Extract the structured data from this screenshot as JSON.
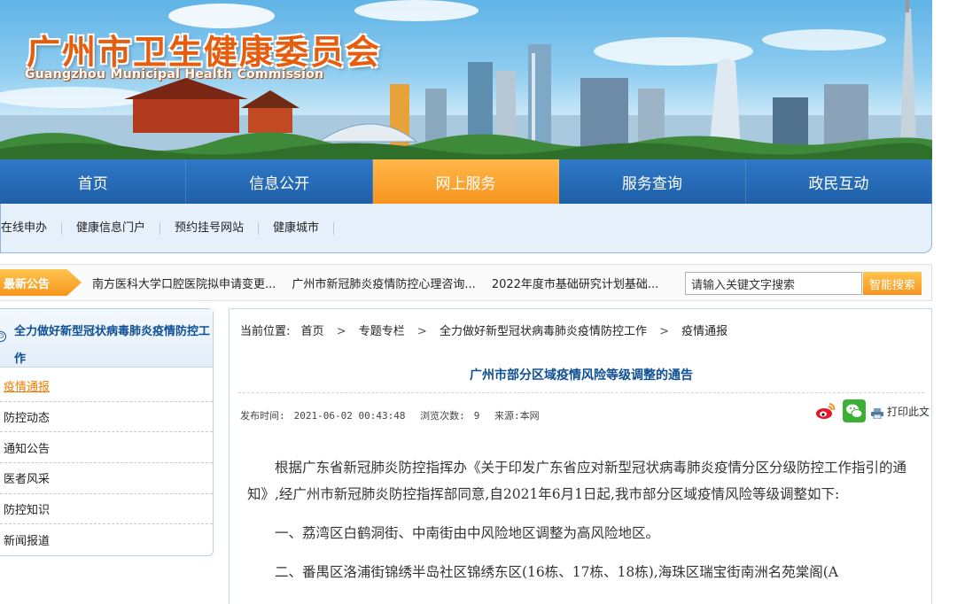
{
  "header": {
    "title": "广州市卫生健康委员会",
    "subtitle": "Guangzhou Municipal Health Commission"
  },
  "nav": {
    "items": [
      {
        "label": "首页"
      },
      {
        "label": "信息公开"
      },
      {
        "label": "网上服务"
      },
      {
        "label": "服务查询"
      },
      {
        "label": "政民互动"
      }
    ],
    "active_index": 2
  },
  "subnav": {
    "items": [
      {
        "label": "在线申办"
      },
      {
        "label": "健康信息门户"
      },
      {
        "label": "预约挂号网站"
      },
      {
        "label": "健康城市"
      }
    ]
  },
  "notice": {
    "label": "最新公告",
    "items": [
      {
        "text": "南方医科大学口腔医院拟申请变更..."
      },
      {
        "text": "广州市新冠肺炎疫情防控心理咨询..."
      },
      {
        "text": "2022年度市基础研究计划基础..."
      }
    ]
  },
  "search": {
    "placeholder": "请输入关键文字搜索",
    "button_label": "智能搜索"
  },
  "sidebar": {
    "heading": "全力做好新型冠状病毒肺炎疫情防控工作",
    "items": [
      {
        "label": "疫情通报"
      },
      {
        "label": "防控动态"
      },
      {
        "label": "通知公告"
      },
      {
        "label": "医者风采"
      },
      {
        "label": "防控知识"
      },
      {
        "label": "新闻报道"
      }
    ],
    "active_index": 0
  },
  "breadcrumb": {
    "prefix": "当前位置:",
    "items": [
      "首页",
      "专题专栏",
      "全力做好新型冠状病毒肺炎疫情防控工作",
      "疫情通报"
    ],
    "separator": ">"
  },
  "article": {
    "title": "广州市部分区域疫情风险等级调整的通告",
    "publish_label": "发布时间:",
    "publish_time": "2021-06-02 00:43:48",
    "views_label": "浏览次数:",
    "views": "9",
    "source_label": "来源:",
    "source": "本网",
    "print_label": "打印此文",
    "paragraphs": [
      "根据广东省新冠肺炎防控指挥办《关于印发广东省应对新型冠状病毒肺炎疫情分区分级防控工作指引的通知》,经广州市新冠肺炎防控指挥部同意,自2021年6月1日起,我市部分区域疫情风险等级调整如下:",
      "一、荔湾区白鹤洞街、中南街由中风险地区调整为高风险地区。",
      "二、番禺区洛浦街锦绣半岛社区锦绣东区(16栋、17栋、18栋),海珠区瑞宝街南洲名苑棠阁(A"
    ]
  },
  "colors": {
    "nav_blue": "#1f5fa8",
    "accent_orange": "#f7941d",
    "link_blue": "#0d4f94",
    "title_orange": "#e85c0d"
  }
}
